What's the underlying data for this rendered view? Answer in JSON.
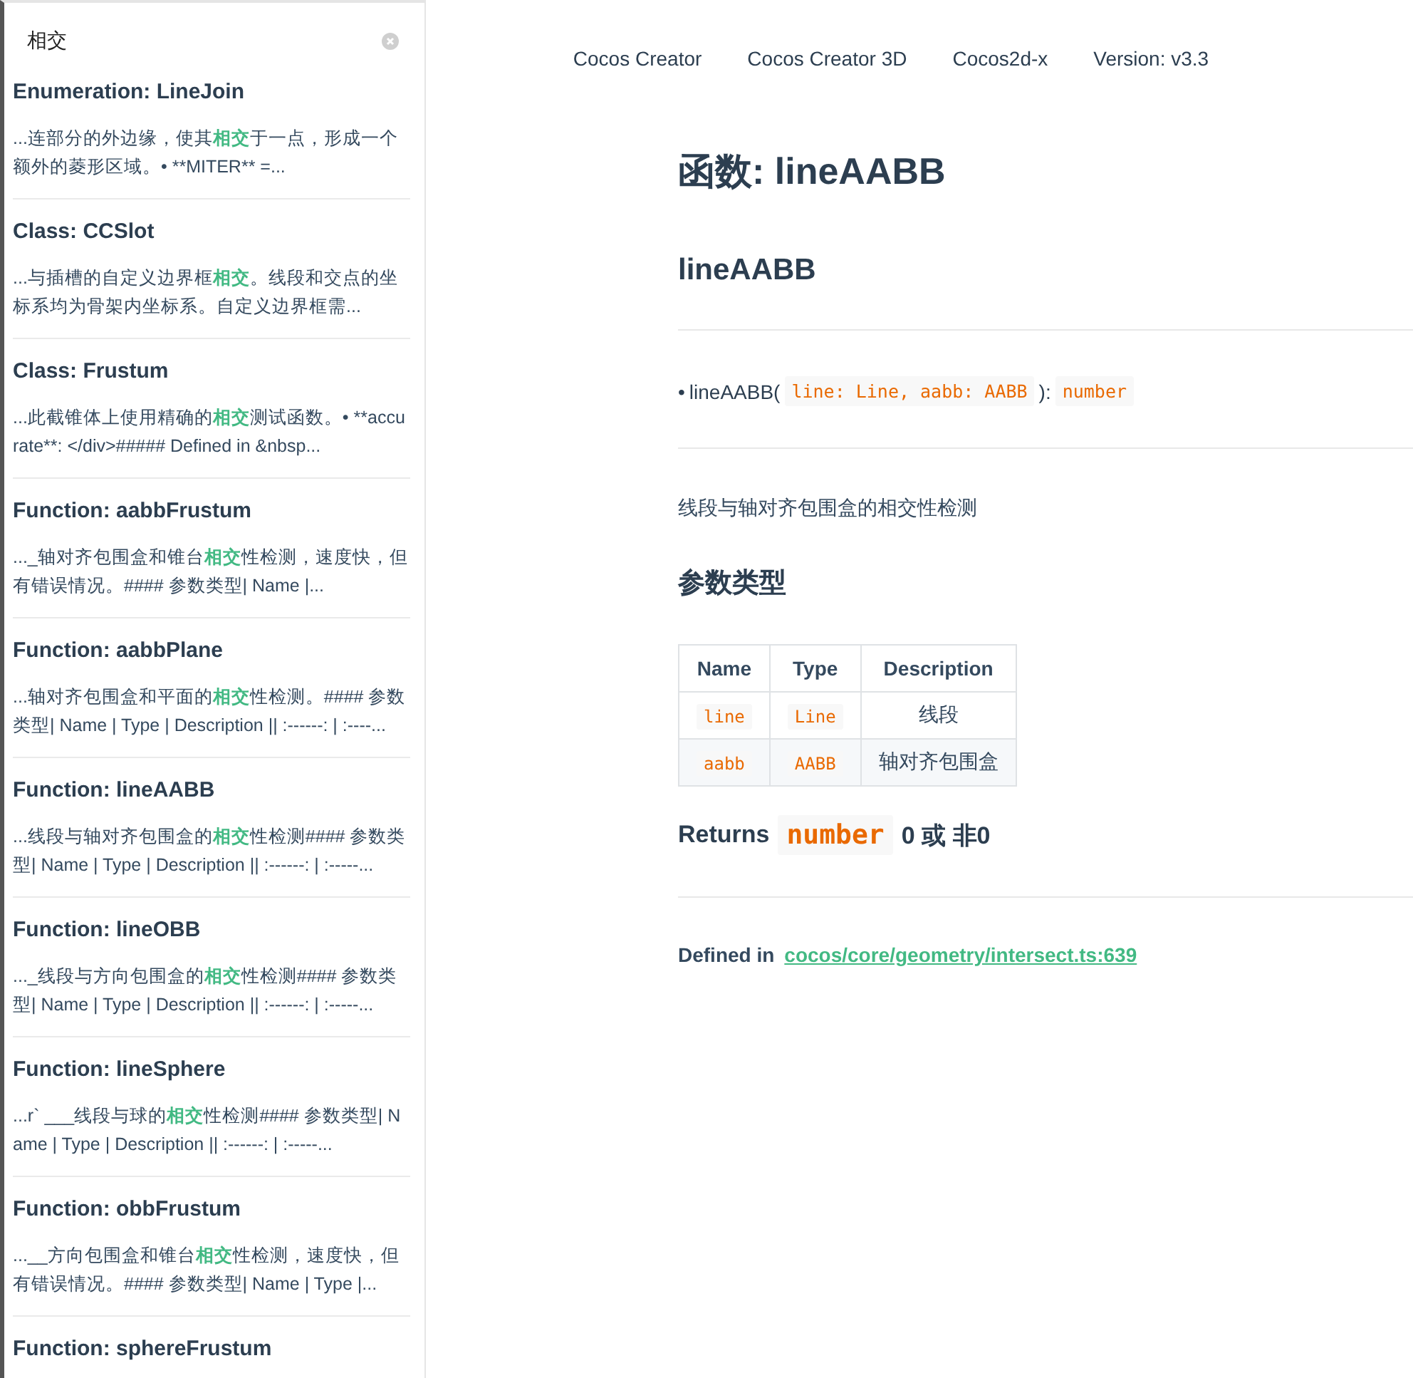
{
  "search": {
    "value": "相交"
  },
  "results": [
    {
      "title": "Enumeration: LineJoin",
      "snippet": {
        "pre": "...连部分的外边缘，使其",
        "hit": "相交",
        "post": "于一点，形成一个额外的菱形区域。• **MITER** =..."
      }
    },
    {
      "title": "Class: CCSlot",
      "snippet": {
        "pre": "...与插槽的自定义边界框",
        "hit": "相交",
        "post": "。线段和交点的坐标系均为骨架内坐标系。自定义边界框需..."
      }
    },
    {
      "title": "Class: Frustum",
      "snippet": {
        "pre": "...此截锥体上使用精确的",
        "hit": "相交",
        "post": "测试函数。• **accurate**: </div>##### Defined in &nbsp..."
      }
    },
    {
      "title": "Function: aabbFrustum",
      "snippet": {
        "pre": "..._轴对齐包围盒和锥台",
        "hit": "相交",
        "post": "性检测，速度快，但有错误情况。#### 参数类型| Name |..."
      }
    },
    {
      "title": "Function: aabbPlane",
      "snippet": {
        "pre": "...轴对齐包围盒和平面的",
        "hit": "相交",
        "post": "性检测。#### 参数类型| Name | Type | Description || :------: | :----..."
      }
    },
    {
      "title": "Function: lineAABB",
      "snippet": {
        "pre": "...线段与轴对齐包围盒的",
        "hit": "相交",
        "post": "性检测#### 参数类型| Name | Type | Description || :------: | :-----..."
      }
    },
    {
      "title": "Function: lineOBB",
      "snippet": {
        "pre": "..._线段与方向包围盒的",
        "hit": "相交",
        "post": "性检测#### 参数类型| Name | Type | Description || :------: | :-----..."
      }
    },
    {
      "title": "Function: lineSphere",
      "snippet": {
        "pre": "...r` ___线段与球的",
        "hit": "相交",
        "post": "性检测#### 参数类型| Name | Type | Description || :------: | :-----..."
      }
    },
    {
      "title": "Function: obbFrustum",
      "snippet": {
        "pre": "...__方向包围盒和锥台",
        "hit": "相交",
        "post": "性检测，速度快，但有错误情况。#### 参数类型| Name | Type |..."
      }
    },
    {
      "title": "Function: sphereFrustum"
    }
  ],
  "nav": [
    "Cocos Creator",
    "Cocos Creator 3D",
    "Cocos2d-x",
    "Version: v3.3"
  ],
  "page_title": "函数: lineAABB",
  "section_title": "lineAABB",
  "signature": {
    "bullet": "•",
    "name": "lineAABB(",
    "params": "line: Line, aabb: AABB",
    "close": "):",
    "returns": "number"
  },
  "description": "线段与轴对齐包围盒的相交性检测",
  "params_heading": "参数类型",
  "table": {
    "columns": [
      "Name",
      "Type",
      "Description"
    ],
    "rows": [
      [
        "line",
        "Line",
        "线段"
      ],
      [
        "aabb",
        "AABB",
        "轴对齐包围盒"
      ]
    ]
  },
  "returns": {
    "label": "Returns",
    "type": "number",
    "text": "0 或 非0"
  },
  "defined_in": {
    "label": "Defined in",
    "link": "cocos/core/geometry/intersect.ts:639"
  }
}
